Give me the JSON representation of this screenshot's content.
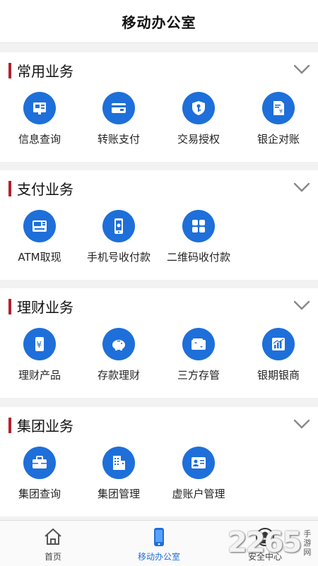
{
  "header": {
    "title": "移动办公室"
  },
  "sections": [
    {
      "title": "常用业务",
      "items": [
        {
          "label": "信息查询",
          "icon": "info-board-icon"
        },
        {
          "label": "转账支付",
          "icon": "card-icon"
        },
        {
          "label": "交易授权",
          "icon": "shield-key-icon"
        },
        {
          "label": "银企对账",
          "icon": "document-yuan-icon"
        }
      ]
    },
    {
      "title": "支付业务",
      "items": [
        {
          "label": "ATM取现",
          "icon": "atm-icon"
        },
        {
          "label": "手机号收付款",
          "icon": "phone-icon"
        },
        {
          "label": "二维码收付款",
          "icon": "qr-grid-icon"
        }
      ]
    },
    {
      "title": "理财业务",
      "items": [
        {
          "label": "理财产品",
          "icon": "yuan-tag-icon"
        },
        {
          "label": "存款理财",
          "icon": "piggy-bank-icon"
        },
        {
          "label": "三方存管",
          "icon": "wallet-icon"
        },
        {
          "label": "银期银商",
          "icon": "bar-chart-icon"
        }
      ]
    },
    {
      "title": "集团业务",
      "items": [
        {
          "label": "集团查询",
          "icon": "briefcase-icon"
        },
        {
          "label": "集团管理",
          "icon": "building-icon"
        },
        {
          "label": "虚账户管理",
          "icon": "id-card-icon"
        }
      ]
    }
  ],
  "tabs": [
    {
      "label": "首页",
      "icon": "home-icon"
    },
    {
      "label": "移动办公室",
      "icon": "mobile-icon",
      "active": true
    },
    {
      "label": "安全中心",
      "icon": "user-icon"
    }
  ],
  "watermark": {
    "number": "2265",
    "suffix": "手游网"
  },
  "colors": {
    "accent": "#1e6fd9",
    "section_bar": "#b3202c"
  }
}
